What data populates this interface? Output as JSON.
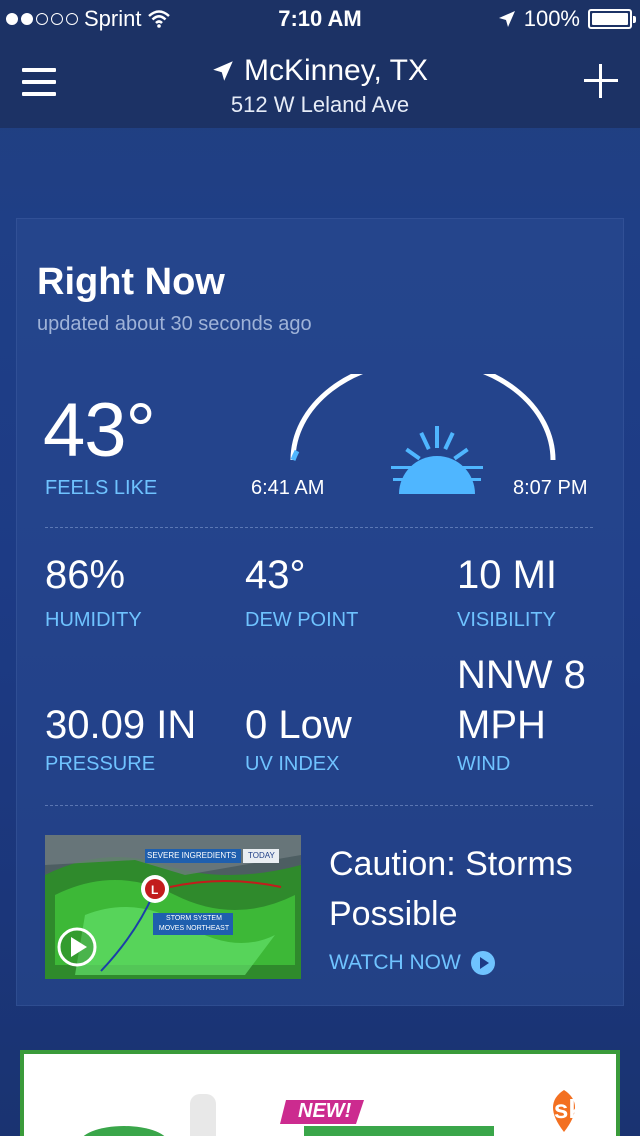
{
  "status_bar": {
    "carrier": "Sprint",
    "time": "7:10 AM",
    "battery": "100%",
    "signal_bars_filled": 2,
    "signal_bars_total": 5
  },
  "header": {
    "city": "McKinney, TX",
    "address": "512 W Leland Ave"
  },
  "right_now": {
    "title": "Right Now",
    "updated": "updated about 30 seconds ago",
    "temperature": "43°",
    "feels_like_label": "FEELS LIKE",
    "sunrise": "6:41 AM",
    "sunset": "8:07 PM",
    "stats": [
      {
        "value": "86%",
        "label": "HUMIDITY"
      },
      {
        "value": "43°",
        "label": "DEW POINT"
      },
      {
        "value": "10 MI",
        "label": "VISIBILITY"
      },
      {
        "value": "30.09 IN",
        "label": "PRESSURE"
      },
      {
        "value": "0 Low",
        "label": "UV INDEX"
      },
      {
        "value_line1": "NNW 8",
        "value_line2": "MPH",
        "label": "WIND"
      }
    ]
  },
  "video": {
    "thumb_tag": "SEVERE INGREDIENTS",
    "thumb_today": "TODAY",
    "thumb_caption": "STORM SYSTEM MOVES NORTHEAST",
    "headline": "Caution: Storms Possible",
    "cta": "WATCH NOW"
  },
  "ad": {
    "badge": "NEW!",
    "brand": "gsk"
  },
  "colors": {
    "accent": "#6fc3ff",
    "background": "#1d3b85",
    "header_bg": "#1c3265"
  }
}
